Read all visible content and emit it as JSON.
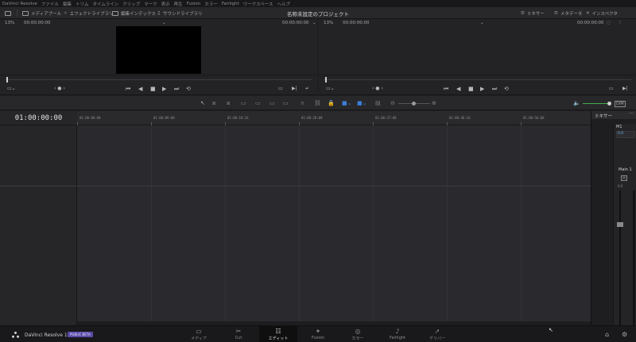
{
  "menu": [
    "DaVinci Resolve",
    "ファイル",
    "編集",
    "トリム",
    "タイムライン",
    "クリップ",
    "マーク",
    "表示",
    "再生",
    "Fusion",
    "カラー",
    "Fairlight",
    "ワークスペース",
    "ヘルプ"
  ],
  "toolbar": {
    "media_pool": "メディアプール",
    "effects_library": "エフェクトライブラリ",
    "edit_index": "編集インデックス",
    "sound_library": "サウンドライブラリ",
    "project_title": "名称未設定のプロジェクト",
    "mixer": "ミキサー",
    "metadata": "メタデータ",
    "inspector": "インスペクタ"
  },
  "viewer_left": {
    "zoom": "13%",
    "timecode": "00:00:00:00",
    "end_timecode": "00:00:00:00"
  },
  "viewer_right": {
    "zoom": "13%",
    "timecode": "00:00:00:00",
    "end_timecode": "00:00:00:00"
  },
  "timeline": {
    "timecode": "01:00:00:00",
    "ruler": [
      "01:00:00:00",
      "01:00:09:08",
      "01:00:18:16",
      "01:00:28:00",
      "01:00:37:08",
      "01:00:46:16",
      "01:00:56:00"
    ]
  },
  "mixer": {
    "title": "ミキサー",
    "track": "M1",
    "track_value": "0.0",
    "bus": "Main 1",
    "mute": "M",
    "level": "0.0"
  },
  "brand": {
    "name": "DaVinci Resolve 16",
    "badge": "PUBLIC BETA"
  },
  "pages": [
    {
      "label": "メディア",
      "icon": "▭"
    },
    {
      "label": "Cut",
      "icon": "✂"
    },
    {
      "label": "エディット",
      "icon": "☷"
    },
    {
      "label": "Fusion",
      "icon": "✦"
    },
    {
      "label": "カラー",
      "icon": "◎"
    },
    {
      "label": "Fairlight",
      "icon": "♪"
    },
    {
      "label": "デリバー",
      "icon": "➚"
    }
  ],
  "active_page": "エディット"
}
